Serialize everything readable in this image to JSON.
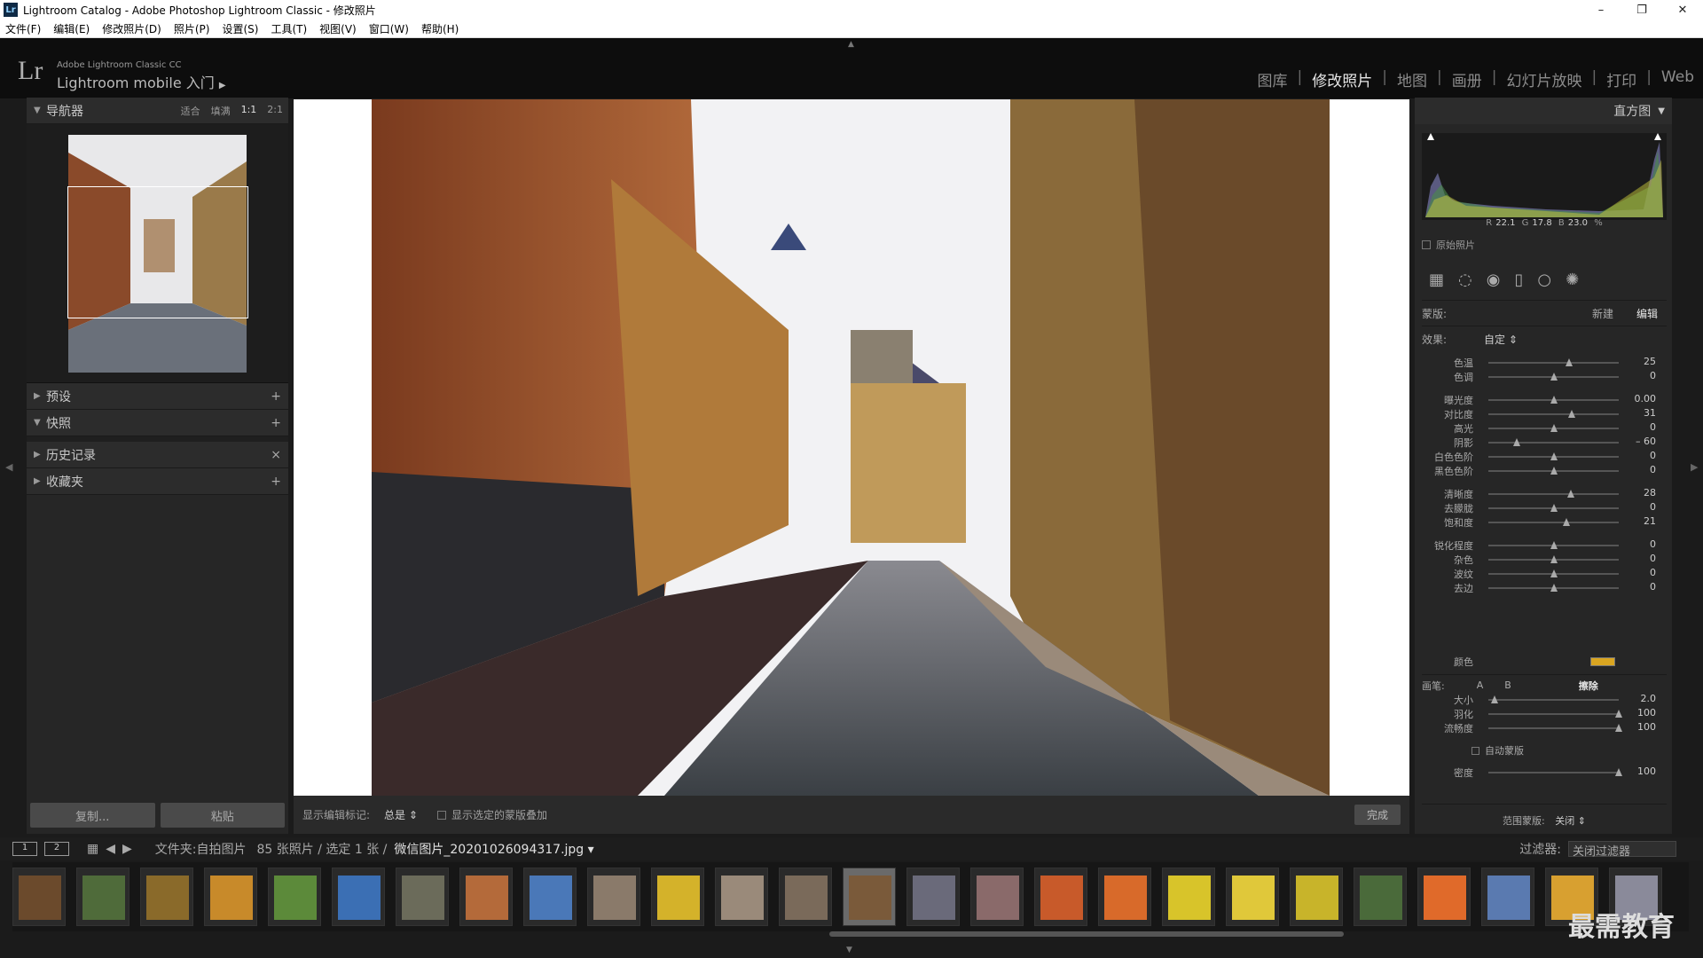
{
  "window": {
    "title": "Lightroom Catalog - Adobe Photoshop Lightroom Classic - 修改照片",
    "minimize": "–",
    "maximize": "❐",
    "close": "✕"
  },
  "menu": [
    "文件(F)",
    "编辑(E)",
    "修改照片(D)",
    "照片(P)",
    "设置(S)",
    "工具(T)",
    "视图(V)",
    "窗口(W)",
    "帮助(H)"
  ],
  "brand": {
    "logo": "Lr",
    "line1": "Adobe Lightroom Classic CC",
    "line2": "Lightroom mobile 入门"
  },
  "modules": [
    {
      "label": "图库",
      "active": false
    },
    {
      "label": "修改照片",
      "active": true
    },
    {
      "label": "地图",
      "active": false
    },
    {
      "label": "画册",
      "active": false
    },
    {
      "label": "幻灯片放映",
      "active": false
    },
    {
      "label": "打印",
      "active": false
    },
    {
      "label": "Web",
      "active": false
    }
  ],
  "left": {
    "navigator": {
      "title": "导航器",
      "zooms": [
        "适合",
        "填满",
        "1:1",
        "2:1"
      ]
    },
    "panels": [
      {
        "title": "预设",
        "action": "+"
      },
      {
        "title": "快照",
        "action": "+"
      },
      {
        "title": "历史记录",
        "action": "×"
      },
      {
        "title": "收藏夹",
        "action": "+"
      }
    ],
    "copy": "复制...",
    "paste": "粘贴"
  },
  "toolbar": {
    "label": "显示编辑标记:",
    "value": "总是",
    "overlay": "显示选定的蒙版叠加",
    "done": "完成"
  },
  "right": {
    "histogram": {
      "title": "直方图",
      "r_label": "R",
      "r": "22.1",
      "g_label": "G",
      "g": "17.8",
      "b_label": "B",
      "b": "23.0",
      "pct": "%"
    },
    "original": "原始照片",
    "mask": {
      "label": "蒙版:",
      "new": "新建",
      "edit": "编辑"
    },
    "effect": {
      "label": "效果:",
      "value": "自定"
    },
    "sliders": [
      {
        "label": "色温",
        "value": "25",
        "pos": 0.62
      },
      {
        "label": "色调",
        "value": "0",
        "pos": 0.5
      },
      {
        "label": "曝光度",
        "value": "0.00",
        "pos": 0.5
      },
      {
        "label": "对比度",
        "value": "31",
        "pos": 0.64
      },
      {
        "label": "高光",
        "value": "0",
        "pos": 0.5
      },
      {
        "label": "阴影",
        "value": "– 60",
        "pos": 0.22
      },
      {
        "label": "白色色阶",
        "value": "0",
        "pos": 0.5
      },
      {
        "label": "黑色色阶",
        "value": "0",
        "pos": 0.5
      },
      {
        "label": "清晰度",
        "value": "28",
        "pos": 0.63
      },
      {
        "label": "去朦胧",
        "value": "0",
        "pos": 0.5
      },
      {
        "label": "饱和度",
        "value": "21",
        "pos": 0.6
      },
      {
        "label": "锐化程度",
        "value": "0",
        "pos": 0.5
      },
      {
        "label": "杂色",
        "value": "0",
        "pos": 0.5
      },
      {
        "label": "波纹",
        "value": "0",
        "pos": 0.5
      },
      {
        "label": "去边",
        "value": "0",
        "pos": 0.5
      }
    ],
    "color": {
      "label": "颜色",
      "swatch": "#d9a521"
    },
    "brush": {
      "label": "画笔:",
      "a": "A",
      "b": "B",
      "erase": "擦除"
    },
    "brush_sliders": [
      {
        "label": "大小",
        "value": "2.0",
        "pos": 0.05
      },
      {
        "label": "羽化",
        "value": "100",
        "pos": 1.0
      },
      {
        "label": "流畅度",
        "value": "100",
        "pos": 1.0
      }
    ],
    "automask": "自动蒙版",
    "density": {
      "label": "密度",
      "value": "100",
      "pos": 1.0
    },
    "range": {
      "label": "范围蒙版:",
      "value": "关闭"
    }
  },
  "filmbar": {
    "mon1": "1",
    "mon2": "2",
    "source": "文件夹:自拍图片",
    "count": "85 张照片 / 选定 1 张 /",
    "filename": "微信图片_20201026094317.jpg",
    "filter_label": "过滤器:",
    "filter_value": "关闭过滤器"
  },
  "filmstrip": {
    "colors": [
      "#6b4a2c",
      "#4f6b3a",
      "#8a6a2a",
      "#c88a2a",
      "#5c8a3a",
      "#3b6fb4",
      "#6b6b5a",
      "#b46a3a",
      "#4a78b8",
      "#8a7a6a",
      "#d4b22a",
      "#9a8a7a",
      "#7a6a5a",
      "#7a5a3a",
      "#6a6a7a",
      "#8a6a6a",
      "#c85a2a",
      "#d86a2a",
      "#d8c42a",
      "#e0c83a",
      "#c8b42a",
      "#4a6a3a",
      "#e06a2a",
      "#5a7ab0",
      "#d8a030",
      "#8a8a9a"
    ],
    "selected": 13
  },
  "watermark": "最需教育"
}
